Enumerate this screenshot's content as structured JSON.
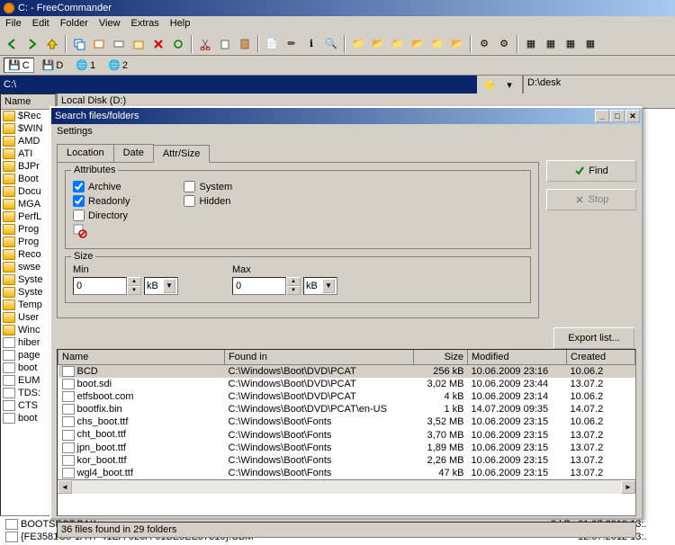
{
  "app": {
    "title": "C: - FreeCommander"
  },
  "menu": [
    "File",
    "Edit",
    "Folder",
    "View",
    "Extras",
    "Help"
  ],
  "drives": [
    {
      "label": "C",
      "active": true
    },
    {
      "label": "D",
      "active": false
    },
    {
      "label": "1",
      "active": false
    },
    {
      "label": "2",
      "active": false
    }
  ],
  "path_left": "C:\\",
  "path_right": "D:\\desk",
  "path_right_sub": "Local Disk (D:)",
  "left_header": "Name",
  "left_items": [
    {
      "name": "$Rec",
      "type": "folder"
    },
    {
      "name": "$WIN",
      "type": "folder"
    },
    {
      "name": "AMD",
      "type": "folder"
    },
    {
      "name": "ATI",
      "type": "folder"
    },
    {
      "name": "BJPr",
      "type": "folder"
    },
    {
      "name": "Boot",
      "type": "folder"
    },
    {
      "name": "Docu",
      "type": "folder"
    },
    {
      "name": "MGA",
      "type": "folder"
    },
    {
      "name": "PerfL",
      "type": "folder"
    },
    {
      "name": "Prog",
      "type": "folder"
    },
    {
      "name": "Prog",
      "type": "folder"
    },
    {
      "name": "Reco",
      "type": "folder"
    },
    {
      "name": "swse",
      "type": "folder"
    },
    {
      "name": "Syste",
      "type": "folder"
    },
    {
      "name": "Syste",
      "type": "folder"
    },
    {
      "name": "Temp",
      "type": "folder"
    },
    {
      "name": "User",
      "type": "folder"
    },
    {
      "name": "Winc",
      "type": "folder"
    },
    {
      "name": "hiber",
      "type": "file"
    },
    {
      "name": "page",
      "type": "file"
    },
    {
      "name": "boot",
      "type": "file"
    },
    {
      "name": "EUM",
      "type": "file"
    },
    {
      "name": "TDS:",
      "type": "file"
    },
    {
      "name": "CTS",
      "type": "file"
    },
    {
      "name": "boot",
      "type": "file"
    }
  ],
  "bottom_files": [
    {
      "name": "BOOTSECT.BAK",
      "size": "8 kB",
      "date": "01.07.2010 13:."
    },
    {
      "name": "{FE3581C5-1A47-41EA-926A-61BE5EE87310}.CBM",
      "size": "",
      "date": "12.07.2012 13:."
    }
  ],
  "dialog": {
    "title": "Search files/folders",
    "menu": "Settings",
    "tabs": [
      "Location",
      "Date",
      "Attr/Size"
    ],
    "active_tab": 2,
    "group_attr": "Attributes",
    "group_size": "Size",
    "attrs": {
      "archive": {
        "label": "Archive",
        "checked": true
      },
      "readonly": {
        "label": "Readonly",
        "checked": true
      },
      "directory": {
        "label": "Directory",
        "checked": false
      },
      "system": {
        "label": "System",
        "checked": false
      },
      "hidden": {
        "label": "Hidden",
        "checked": false
      }
    },
    "size_min_label": "Min",
    "size_max_label": "Max",
    "size_min": "0",
    "size_max": "0",
    "size_unit": "kB",
    "btn_find": "Find",
    "btn_stop": "Stop",
    "btn_export": "Export list...",
    "results_headers": [
      "Name",
      "Found in",
      "Size",
      "Modified",
      "Created"
    ],
    "results": [
      {
        "name": "BCD",
        "path": "C:\\Windows\\Boot\\DVD\\PCAT",
        "size": "256 kB",
        "mod": "10.06.2009 23:16",
        "crt": "10.06.2"
      },
      {
        "name": "boot.sdi",
        "path": "C:\\Windows\\Boot\\DVD\\PCAT",
        "size": "3,02 MB",
        "mod": "10.06.2009 23:44",
        "crt": "13.07.2"
      },
      {
        "name": "etfsboot.com",
        "path": "C:\\Windows\\Boot\\DVD\\PCAT",
        "size": "4 kB",
        "mod": "10.06.2009 23:14",
        "crt": "10.06.2"
      },
      {
        "name": "bootfix.bin",
        "path": "C:\\Windows\\Boot\\DVD\\PCAT\\en-US",
        "size": "1 kB",
        "mod": "14.07.2009 09:35",
        "crt": "14.07.2"
      },
      {
        "name": "chs_boot.ttf",
        "path": "C:\\Windows\\Boot\\Fonts",
        "size": "3,52 MB",
        "mod": "10.06.2009 23:15",
        "crt": "10.06.2"
      },
      {
        "name": "cht_boot.ttf",
        "path": "C:\\Windows\\Boot\\Fonts",
        "size": "3,70 MB",
        "mod": "10.06.2009 23:15",
        "crt": "13.07.2"
      },
      {
        "name": "jpn_boot.ttf",
        "path": "C:\\Windows\\Boot\\Fonts",
        "size": "1,89 MB",
        "mod": "10.06.2009 23:15",
        "crt": "13.07.2"
      },
      {
        "name": "kor_boot.ttf",
        "path": "C:\\Windows\\Boot\\Fonts",
        "size": "2,26 MB",
        "mod": "10.06.2009 23:15",
        "crt": "13.07.2"
      },
      {
        "name": "wgl4_boot.ttf",
        "path": "C:\\Windows\\Boot\\Fonts",
        "size": "47 kB",
        "mod": "10.06.2009 23:15",
        "crt": "13.07.2"
      }
    ],
    "status": "36 files found in 29 folders"
  }
}
